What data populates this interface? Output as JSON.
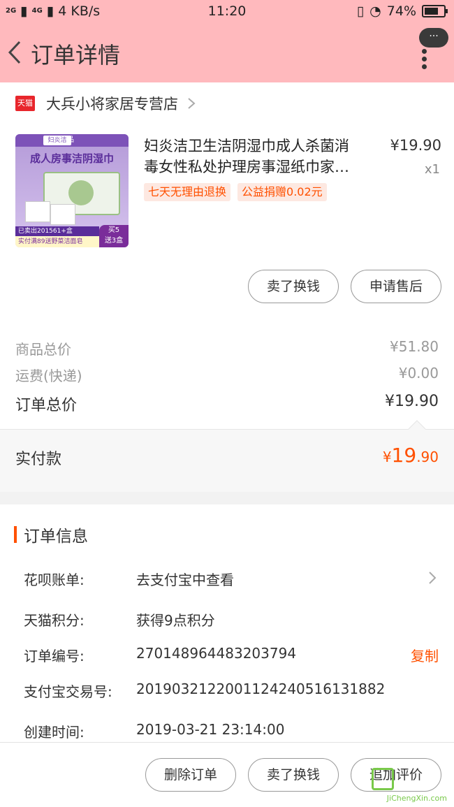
{
  "status_bar": {
    "signal": "2G",
    "signal2": "4G",
    "speed": "4 KB/s",
    "time": "11:20",
    "battery": "74%",
    "battery_level": 0.74
  },
  "header": {
    "title": "订单详情",
    "more_label": "···"
  },
  "shop": {
    "badge": "天猫",
    "name": "大兵小将家居专营店"
  },
  "product": {
    "title_line1": "妇炎洁卫生洁阴湿巾成人杀菌消",
    "title_line2": "毒女性私处护理房事湿纸巾家…",
    "price": "¥19.90",
    "qty": "x1",
    "tags": [
      "七天无理由退换",
      "公益捐赠0.02元"
    ],
    "image": {
      "brand": "妇炎洁",
      "banner": "官网正品",
      "headline": "成人房事洁阴湿巾",
      "sold": "已卖出201561+盒",
      "promo": "实付满89送野菜洁面皂",
      "deal_line1": "买5",
      "deal_line2": "送3盒"
    }
  },
  "actions": {
    "sell": "卖了换钱",
    "after_sale": "申请售后"
  },
  "summary": {
    "goods_label": "商品总价",
    "goods_value": "¥51.80",
    "shipping_label": "运费(快递)",
    "shipping_value": "¥0.00",
    "total_label": "订单总价",
    "total_value": "¥19.90"
  },
  "payment": {
    "label": "实付款",
    "currency": "¥",
    "integer": "19",
    "decimal": ".90"
  },
  "order_info": {
    "title": "订单信息",
    "rows": [
      {
        "key": "花呗账单:",
        "value": "去支付宝中查看"
      },
      {
        "key": "天猫积分:",
        "value": "获得9点积分"
      },
      {
        "key": "订单编号:",
        "value": "270148964483203794",
        "action": "复制"
      },
      {
        "key": "支付宝交易号:",
        "value": "2019032122001124240516131882"
      },
      {
        "key": "创建时间:",
        "value": "2019-03-21 23:14:00"
      }
    ]
  },
  "bottom_bar": {
    "delete": "删除订单",
    "sell": "卖了换钱",
    "review": "追加评价"
  },
  "watermark": {
    "text": "JiChengXin.com"
  },
  "colors": {
    "header_bg": "#ffb9bd",
    "accent": "#ff5000",
    "tmall_red": "#e8262c"
  }
}
